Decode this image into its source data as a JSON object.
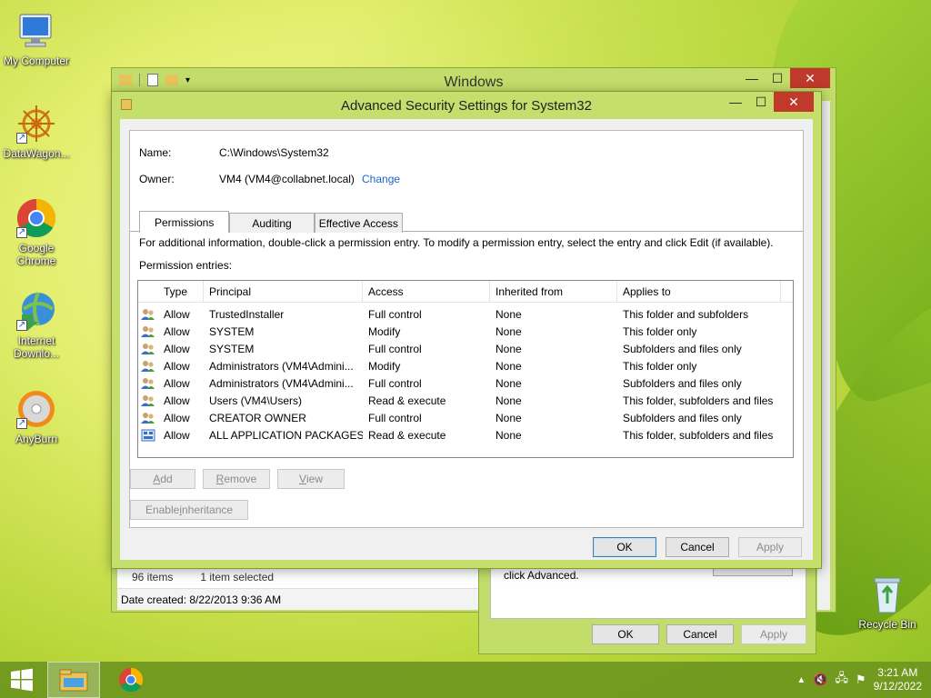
{
  "desktop": {
    "icons": [
      {
        "label": "My Computer"
      },
      {
        "label": "DataWagon..."
      },
      {
        "label": "Google Chrome"
      },
      {
        "label": "Internet Downlo..."
      },
      {
        "label": "AnyBurn"
      },
      {
        "label": "Recycle Bin"
      }
    ]
  },
  "explorer": {
    "title": "Windows",
    "status_count": "96 items",
    "status_selected": "1 item selected",
    "date_created": "Date created: 8/22/2013 9:36 AM"
  },
  "properties": {
    "text": "click Advanced.",
    "ok": "OK",
    "cancel": "Cancel",
    "apply": "Apply"
  },
  "dialog": {
    "title": "Advanced Security Settings for System32",
    "name_label": "Name:",
    "name_value": "C:\\Windows\\System32",
    "owner_label": "Owner:",
    "owner_value": "VM4 (VM4@collabnet.local)",
    "change_link": "Change",
    "tabs": [
      {
        "label": "Permissions"
      },
      {
        "label": "Auditing"
      },
      {
        "label": "Effective Access"
      }
    ],
    "info_text": "For additional information, double-click a permission entry. To modify a permission entry, select the entry and click Edit (if available).",
    "entries_label": "Permission entries:",
    "columns": {
      "type": "Type",
      "principal": "Principal",
      "access": "Access",
      "inherited": "Inherited from",
      "applies": "Applies to"
    },
    "entries": [
      {
        "type": "Allow",
        "principal": "TrustedInstaller",
        "access": "Full control",
        "inherited": "None",
        "applies": "This folder and subfolders"
      },
      {
        "type": "Allow",
        "principal": "SYSTEM",
        "access": "Modify",
        "inherited": "None",
        "applies": "This folder only"
      },
      {
        "type": "Allow",
        "principal": "SYSTEM",
        "access": "Full control",
        "inherited": "None",
        "applies": "Subfolders and files only"
      },
      {
        "type": "Allow",
        "principal": "Administrators (VM4\\Admini...",
        "access": "Modify",
        "inherited": "None",
        "applies": "This folder only"
      },
      {
        "type": "Allow",
        "principal": "Administrators (VM4\\Admini...",
        "access": "Full control",
        "inherited": "None",
        "applies": "Subfolders and files only"
      },
      {
        "type": "Allow",
        "principal": "Users (VM4\\Users)",
        "access": "Read & execute",
        "inherited": "None",
        "applies": "This folder, subfolders and files"
      },
      {
        "type": "Allow",
        "principal": "CREATOR OWNER",
        "access": "Full control",
        "inherited": "None",
        "applies": "Subfolders and files only"
      },
      {
        "type": "Allow",
        "principal": "ALL APPLICATION PACKAGES",
        "access": "Read & execute",
        "inherited": "None",
        "applies": "This folder, subfolders and files"
      }
    ],
    "buttons": {
      "add_pre": "",
      "add_key": "A",
      "add_post": "dd",
      "remove_pre": "",
      "remove_key": "R",
      "remove_post": "emove",
      "view_pre": "",
      "view_key": "V",
      "view_post": "iew",
      "inherit_pre": "Enable ",
      "inherit_key": "i",
      "inherit_post": "nheritance",
      "ok": "OK",
      "cancel": "Cancel",
      "apply": "Apply"
    }
  },
  "taskbar": {
    "time": "3:21 AM",
    "date": "9/12/2022"
  },
  "colors": {
    "window_frame": "#c5df6c",
    "close_button": "#c0392b",
    "link": "#1a64c8",
    "taskbar": "#6e961e"
  }
}
